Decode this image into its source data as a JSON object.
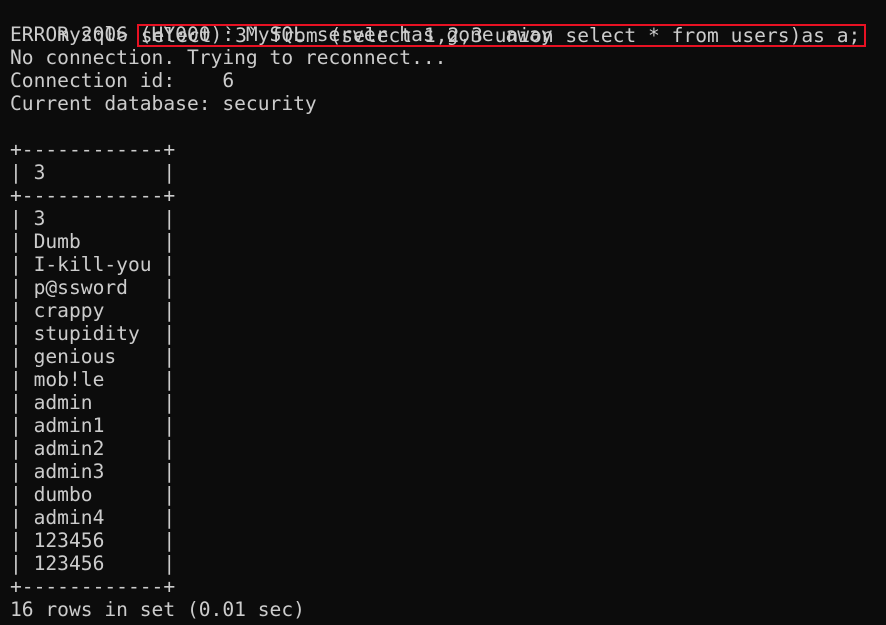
{
  "terminal": {
    "prompt": "mysql> ",
    "command": "select `3` from (select 1,2,3 union select * from users)as a;",
    "highlight_color": "#e81123",
    "messages": [
      "ERROR 2006 (HY000): MySQL server has gone away",
      "No connection. Trying to reconnect...",
      "Connection id:    6",
      "Current database: security"
    ],
    "table": {
      "border": "+------------+",
      "column_width": 11,
      "header": "3",
      "rows": [
        "3",
        "Dumb",
        "I-kill-you",
        "p@ssword",
        "crappy",
        "stupidity",
        "genious",
        "mob!le",
        "admin",
        "admin1",
        "admin2",
        "admin3",
        "dumbo",
        "admin4",
        "123456",
        "123456"
      ]
    },
    "summary": "16 rows in set (0.01 sec)"
  }
}
